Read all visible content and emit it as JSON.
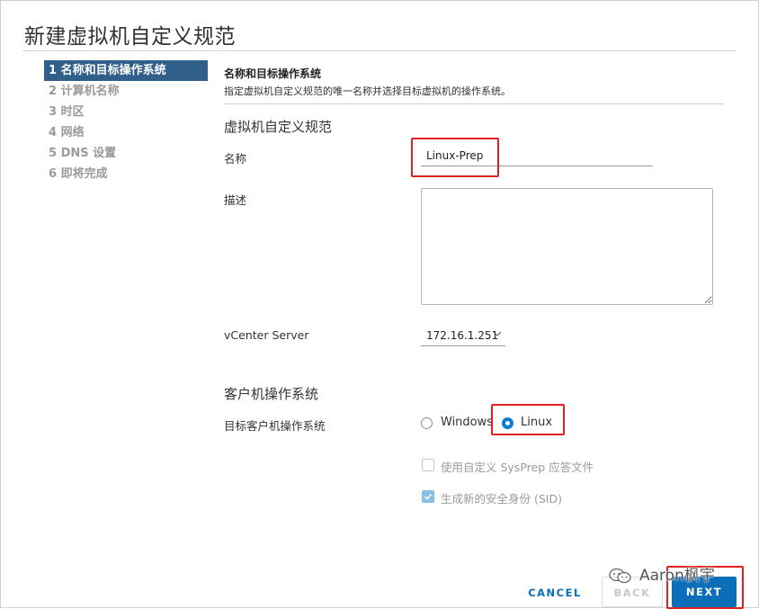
{
  "dialog": {
    "title": "新建虚拟机自定义规范"
  },
  "nav": {
    "items": [
      {
        "label": "1 名称和目标操作系统",
        "active": true
      },
      {
        "label": "2 计算机名称",
        "active": false
      },
      {
        "label": "3 时区",
        "active": false
      },
      {
        "label": "4 网络",
        "active": false
      },
      {
        "label": "5 DNS 设置",
        "active": false
      },
      {
        "label": "6 即将完成",
        "active": false
      }
    ]
  },
  "step": {
    "heading": "名称和目标操作系统",
    "description": "指定虚拟机自定义规范的唯一名称并选择目标虚拟机的操作系统。"
  },
  "spec": {
    "section_title": "虚拟机自定义规范",
    "name_label": "名称",
    "name_value": "Linux-Prep",
    "description_label": "描述",
    "description_value": "",
    "vcenter_label": "vCenter Server",
    "vcenter_value": "172.16.1.251"
  },
  "guest_os": {
    "section_title": "客户机操作系统",
    "target_label": "目标客户机操作系统",
    "options": [
      {
        "label": "Windows",
        "selected": false
      },
      {
        "label": "Linux",
        "selected": true
      }
    ],
    "use_custom_sysprep": {
      "label": "使用自定义 SysPrep 应答文件",
      "checked": false
    },
    "generate_sid": {
      "label": "生成新的安全身份 (SID)",
      "checked": true
    }
  },
  "footer": {
    "cancel_label": "CANCEL",
    "back_label": "BACK",
    "next_label": "NEXT"
  },
  "watermark": {
    "text": "Aaron枫宇"
  },
  "colors": {
    "accent": "#0a6fb8",
    "nav_active": "#2f5f8a",
    "highlight": "#e02020",
    "radio_on": "#0a7bd6"
  }
}
